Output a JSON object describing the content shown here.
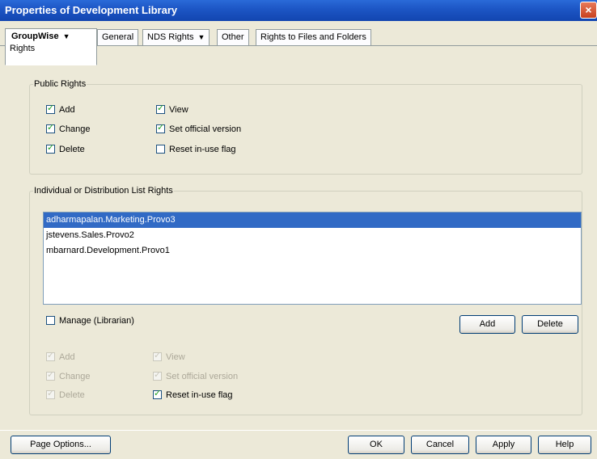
{
  "window": {
    "title": "Properties of Development Library",
    "close_glyph": "×"
  },
  "tabs": [
    {
      "label": "GroupWise",
      "sublabel": "Rights",
      "dropdown": true,
      "active": true
    },
    {
      "label": "General"
    },
    {
      "label": "NDS Rights",
      "dropdown": true
    },
    {
      "label": "Other"
    },
    {
      "label": "Rights to Files and Folders"
    }
  ],
  "public_rights": {
    "legend": "Public Rights",
    "items": [
      {
        "label": "Add",
        "checked": true
      },
      {
        "label": "Change",
        "checked": true
      },
      {
        "label": "Delete",
        "checked": true
      },
      {
        "label": "View",
        "checked": true
      },
      {
        "label": "Set official version",
        "checked": true
      },
      {
        "label": "Reset in-use flag",
        "checked": false
      }
    ]
  },
  "individual_rights": {
    "legend": "Individual or Distribution List Rights",
    "list": [
      {
        "text": "adharmapalan.Marketing.Provo3",
        "selected": true
      },
      {
        "text": "jstevens.Sales.Provo2",
        "selected": false
      },
      {
        "text": "mbarnard.Development.Provo1",
        "selected": false
      }
    ],
    "manage_label": "Manage (Librarian)",
    "manage_checked": false,
    "add_button": "Add",
    "delete_button": "Delete",
    "items": [
      {
        "label": "Add",
        "checked": true,
        "disabled": true
      },
      {
        "label": "Change",
        "checked": true,
        "disabled": true
      },
      {
        "label": "Delete",
        "checked": true,
        "disabled": true
      },
      {
        "label": "View",
        "checked": true,
        "disabled": true
      },
      {
        "label": "Set official version",
        "checked": true,
        "disabled": true
      },
      {
        "label": "Reset in-use flag",
        "checked": true,
        "disabled": false
      }
    ]
  },
  "footer": {
    "page_options": "Page Options...",
    "ok": "OK",
    "cancel": "Cancel",
    "apply": "Apply",
    "help": "Help"
  },
  "icons": {
    "dropdown": "chevron-down-icon",
    "close": "close-icon",
    "check": "check-icon"
  }
}
